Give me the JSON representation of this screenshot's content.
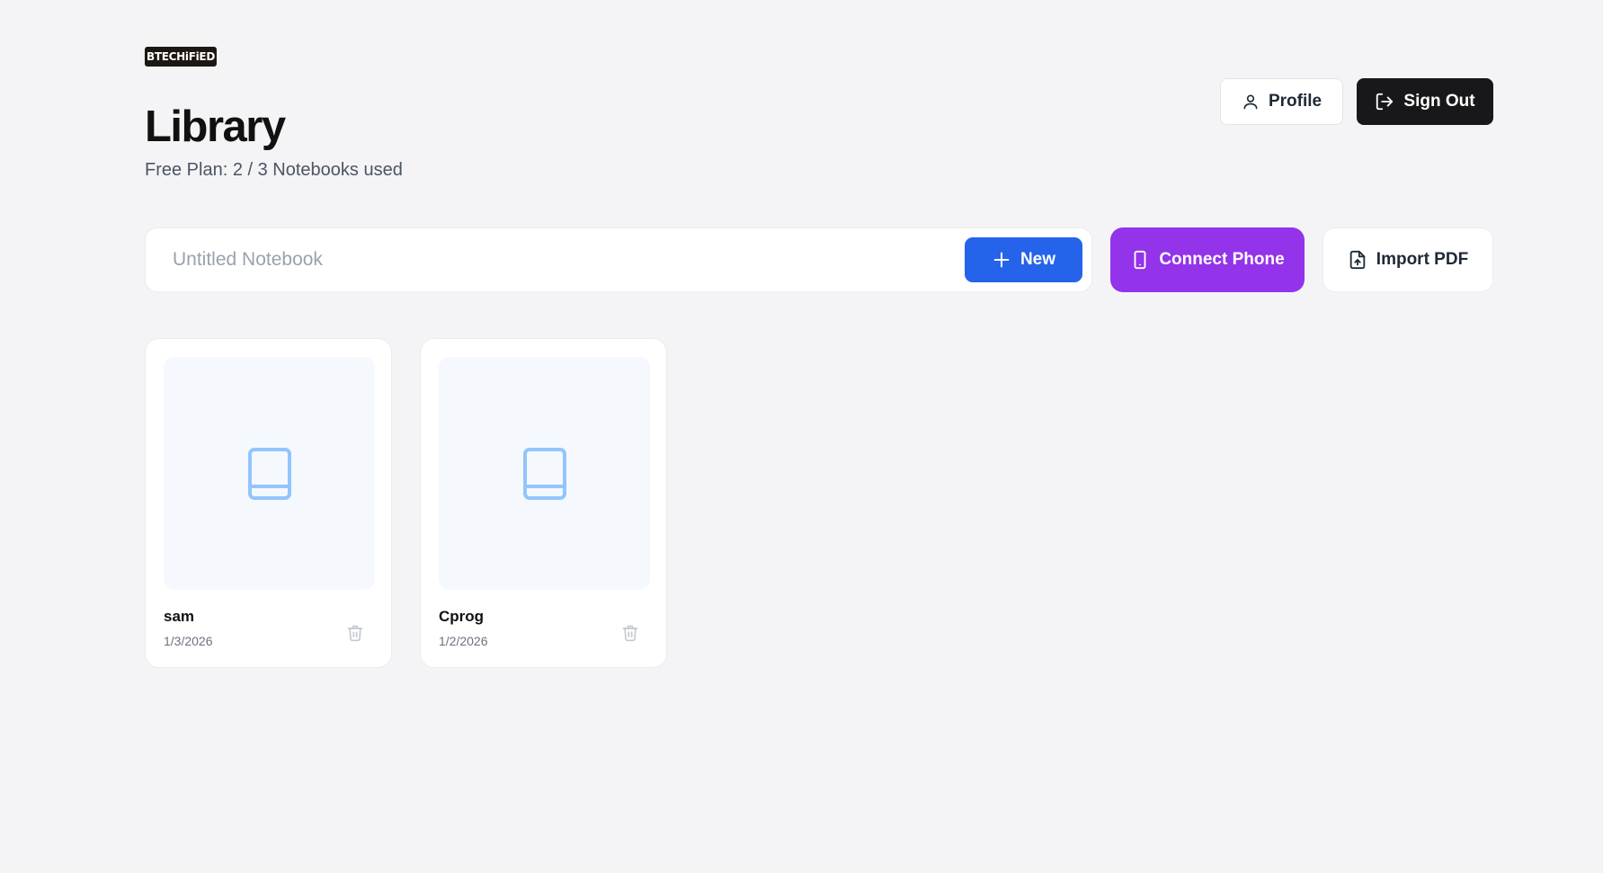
{
  "brand": {
    "logo_text": "BTECHiFiED"
  },
  "header": {
    "title": "Library",
    "plan_text": "Free Plan: 2 / 3 Notebooks used",
    "profile_label": "Profile",
    "signout_label": "Sign Out"
  },
  "toolbar": {
    "notebook_placeholder": "Untitled Notebook",
    "notebook_value": "",
    "new_label": "New",
    "connect_label": "Connect Phone",
    "import_label": "Import PDF"
  },
  "notebooks": [
    {
      "title": "sam",
      "date": "1/3/2026",
      "icon": "book-icon"
    },
    {
      "title": "Cprog",
      "date": "1/2/2026",
      "icon": "book-icon"
    }
  ],
  "colors": {
    "background": "#f4f4f6",
    "primary_blue": "#2563eb",
    "connect_purple": "#9333ea",
    "signout_dark": "#18181b",
    "book_icon": "#93c5fd"
  },
  "icons": {
    "profile": "user-icon",
    "signout": "logout-icon",
    "new": "plus-icon",
    "connect": "smartphone-icon",
    "import": "file-upload-icon",
    "delete": "trash-icon"
  }
}
